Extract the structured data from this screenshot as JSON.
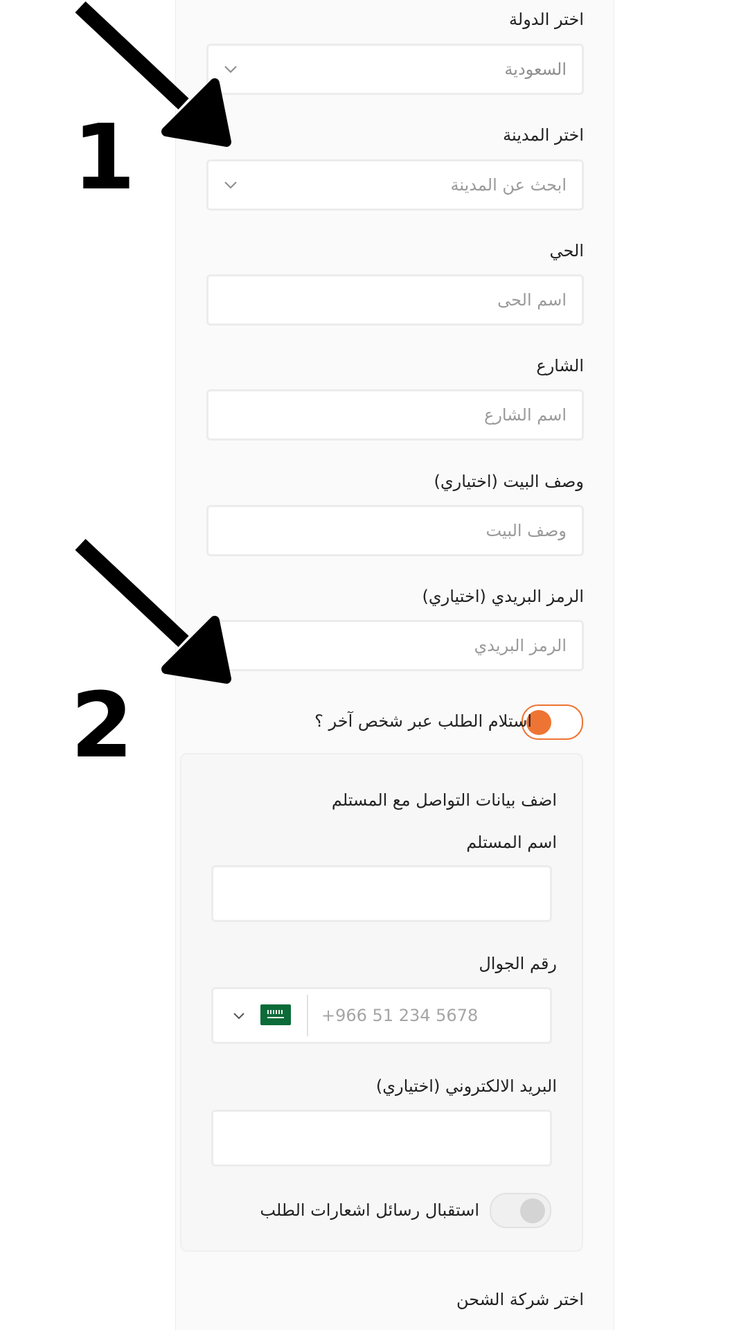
{
  "address": {
    "country_label": "اختر الدولة",
    "country_value": "السعودية",
    "city_label": "اختر المدينة",
    "city_placeholder": "ابحث عن المدينة",
    "district_label": "الحي",
    "district_placeholder": "اسم الحى",
    "street_label": "الشارع",
    "street_placeholder": "اسم الشارع",
    "house_label": "وصف البيت (اختياري)",
    "house_placeholder": "وصف البيت",
    "postal_label": "الرمز البريدي (اختياري)",
    "postal_placeholder": "الرمز البريدي"
  },
  "other_recipient": {
    "toggle_label": "استلام الطلب عبر شخص آخر ؟",
    "toggle_on": true,
    "section_title": "اضف بيانات التواصل مع المستلم",
    "name_label": "اسم المستلم",
    "phone_label": "رقم الجوال",
    "phone_placeholder": "+966 51 234 5678",
    "email_label": "البريد الالكتروني (اختياري)",
    "notify_label": "استقبال رسائل اشعارات الطلب",
    "notify_on": false
  },
  "shipping": {
    "company_label": "اختر شركة الشحن"
  },
  "annotations": {
    "marker_1": "1",
    "marker_2": "2"
  },
  "colors": {
    "accent_orange": "#ee7433",
    "flag_green": "#0b6b39",
    "border_gray": "#ececec"
  },
  "icons": {
    "dropdown": "chevron-down-icon",
    "flag": "saudi-flag-icon",
    "arrow": "arrow-down-right-icon"
  }
}
